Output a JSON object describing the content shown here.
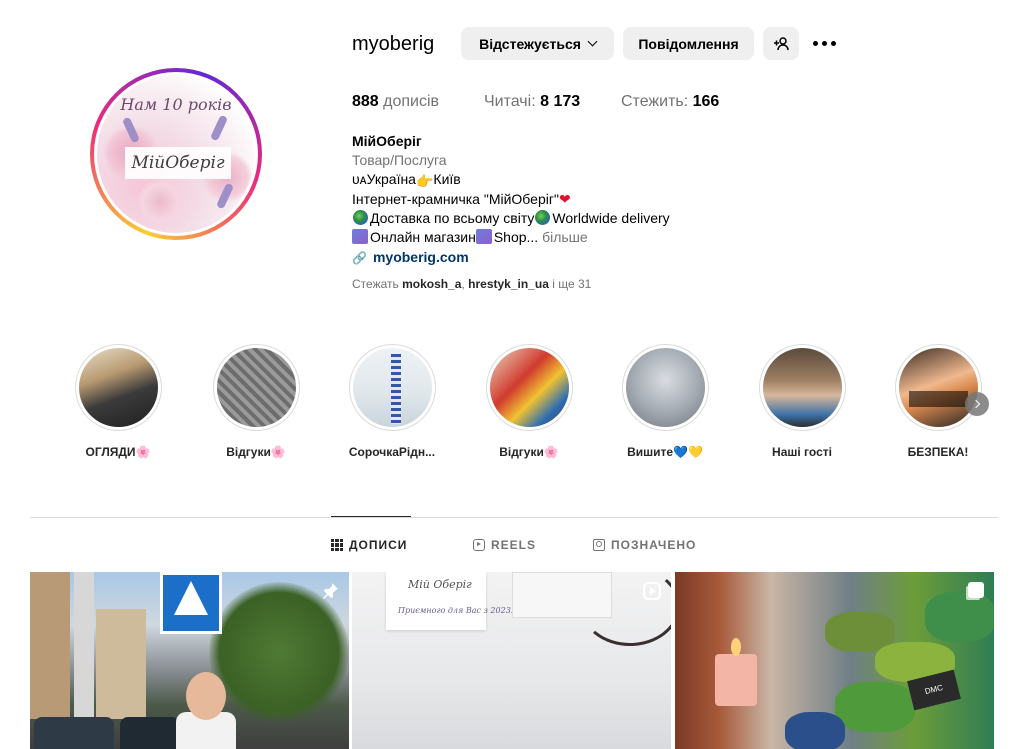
{
  "profile": {
    "username": "myoberig",
    "avatar_title": "Нам 10 років",
    "avatar_label": "МійОберіг",
    "buttons": {
      "following": "Відстежується",
      "message": "Повідомлення"
    },
    "stats": {
      "posts_count": "888",
      "posts_label": "дописів",
      "followers_label": "Читачі:",
      "followers_count": "8 173",
      "following_label": "Стежить:",
      "following_count": "166"
    },
    "bio": {
      "name": "МійОберіг",
      "category": "Товар/Послуга",
      "line1_a": "ᴜᴀУкраїна",
      "line1_b": "Київ",
      "line2": "Інтернет-крамничка \"МійОберіг\"",
      "line3_a": "Доставка по всьому світу",
      "line3_b": "Worldwide delivery",
      "line4_a": "Онлайн магазин",
      "line4_b": "Shop...",
      "more": "більше",
      "link": "myoberig.com"
    },
    "followed_by": {
      "prefix": "Стежать",
      "user1": "mokosh_a",
      "sep": ",",
      "user2": "hrestyk_in_ua",
      "suffix": "і ще 31"
    }
  },
  "highlights": [
    {
      "label": "ОГЛЯДИ🌸"
    },
    {
      "label": "Відгуки🌸"
    },
    {
      "label": "СорочкаРідн..."
    },
    {
      "label": "Відгуки🌸"
    },
    {
      "label": "Вишите💙💛"
    },
    {
      "label": "Наші гості"
    },
    {
      "label": "БЕЗПЕКА!"
    }
  ],
  "tabs": {
    "posts": "ДОПИСИ",
    "reels": "REELS",
    "tagged": "ПОЗНАЧЕНО"
  },
  "posts": {
    "card_brand": "Мій Оберіг",
    "card_line": "Приємного для Вас з 2023!",
    "tag_text": "DMC"
  },
  "colors": {
    "link": "#00376b",
    "secondary_text": "#737373",
    "button_bg": "#efefef"
  },
  "icons": {
    "following_chevron": "chevron-down-icon",
    "add_user": "add-user-icon",
    "more": "more-icon",
    "link": "link-icon",
    "posts_tab": "grid-icon",
    "reels_tab": "reels-icon",
    "tagged_tab": "tagged-icon",
    "pinned": "pin-icon",
    "reel": "reel-icon",
    "carousel": "carousel-icon"
  }
}
